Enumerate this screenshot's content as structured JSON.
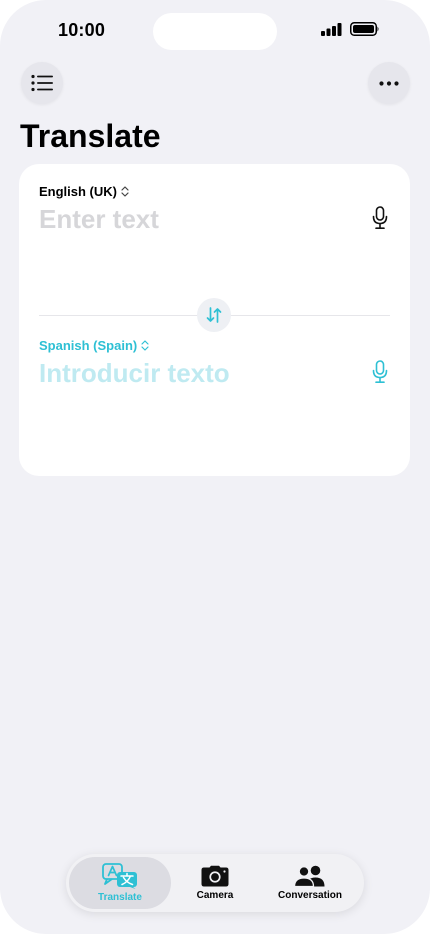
{
  "status": {
    "time": "10:00"
  },
  "header": {
    "title": "Translate"
  },
  "source": {
    "language": "English (UK)",
    "placeholder": "Enter text"
  },
  "target": {
    "language": "Spanish (Spain)",
    "placeholder": "Introducir texto"
  },
  "tabs": [
    {
      "label": "Translate",
      "icon": "translate-icon",
      "active": true
    },
    {
      "label": "Camera",
      "icon": "camera-icon",
      "active": false
    },
    {
      "label": "Conversation",
      "icon": "people-icon",
      "active": false
    }
  ],
  "colors": {
    "accent": "#2ec0d4",
    "background": "#f1f1f6",
    "card": "#ffffff",
    "placeholder": "#d6d6d9"
  }
}
